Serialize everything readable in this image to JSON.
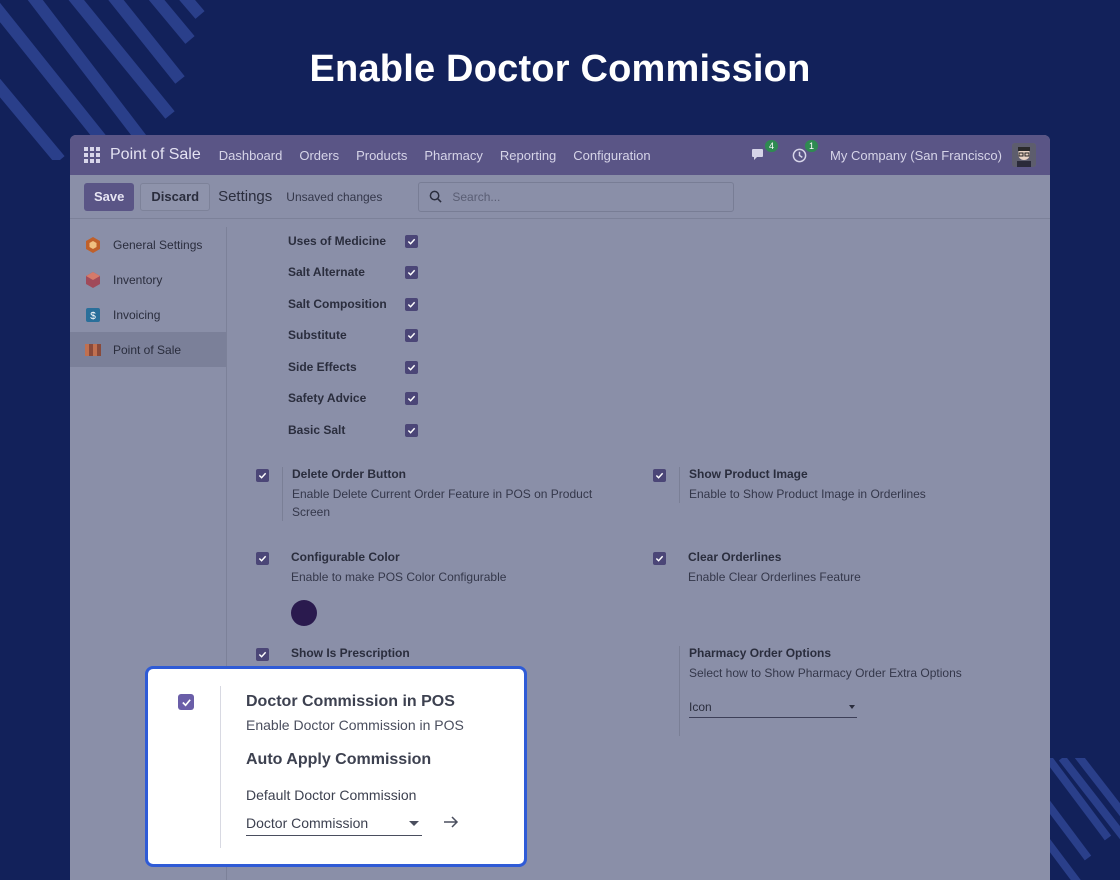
{
  "hero": {
    "title": "Enable Doctor Commission"
  },
  "navbar": {
    "brand": "Point of Sale",
    "items": [
      "Dashboard",
      "Orders",
      "Products",
      "Pharmacy",
      "Reporting",
      "Configuration"
    ],
    "chat_badge": "4",
    "activity_badge": "1",
    "company": "My Company (San Francisco)"
  },
  "controlbar": {
    "save_label": "Save",
    "discard_label": "Discard",
    "title": "Settings",
    "status": "Unsaved changes",
    "search_placeholder": "Search..."
  },
  "sidebar": {
    "items": [
      {
        "label": "General Settings",
        "icon": "general-settings-icon",
        "color": "#c0602a"
      },
      {
        "label": "Inventory",
        "icon": "inventory-icon",
        "color": "#a04a5a"
      },
      {
        "label": "Invoicing",
        "icon": "invoicing-icon",
        "color": "#2a6f9a"
      },
      {
        "label": "Point of Sale",
        "icon": "point-of-sale-icon",
        "color": "#8a4a3a"
      }
    ],
    "active": "Point of Sale"
  },
  "features": [
    {
      "label": "Uses of Medicine",
      "checked": true
    },
    {
      "label": "Salt Alternate",
      "checked": true
    },
    {
      "label": "Salt Composition",
      "checked": true
    },
    {
      "label": "Substitute",
      "checked": true
    },
    {
      "label": "Side Effects",
      "checked": true
    },
    {
      "label": "Safety Advice",
      "checked": true
    },
    {
      "label": "Basic Salt",
      "checked": true
    }
  ],
  "settings": {
    "delete_order": {
      "title": "Delete Order Button",
      "desc": "Enable Delete Current Order Feature in POS on Product Screen",
      "checked": true
    },
    "show_image": {
      "title": "Show Product Image",
      "desc": "Enable to Show Product Image in Orderlines",
      "checked": true
    },
    "config_color": {
      "title": "Configurable Color",
      "desc": "Enable to make POS Color Configurable",
      "checked": true,
      "color": "#2a1a4e"
    },
    "clear_orderlines": {
      "title": "Clear Orderlines",
      "desc": "Enable Clear Orderlines Feature",
      "checked": true
    },
    "prescription": {
      "title": "Show Is Prescription",
      "checked": true
    },
    "pharmacy_options": {
      "title": "Pharmacy Order Options",
      "desc": "Select how to Show Pharmacy Order Extra Options",
      "value": "Icon"
    }
  },
  "callout": {
    "title": "Doctor Commission in POS",
    "desc": "Enable Doctor Commission in POS",
    "auto_apply": "Auto Apply Commission",
    "default_label": "Default Doctor Commission",
    "default_value": "Doctor Commission",
    "checked": true,
    "border_color": "#2f5bd6"
  }
}
